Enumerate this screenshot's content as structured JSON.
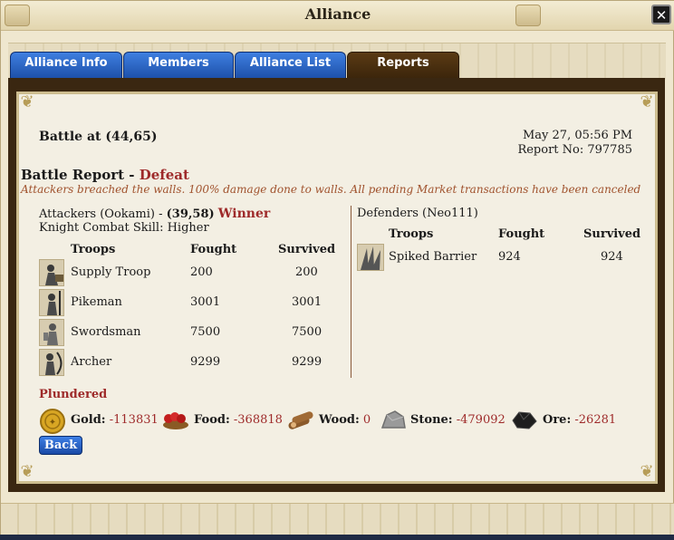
{
  "window": {
    "title": "Alliance",
    "close_label": "✕"
  },
  "tabs": [
    {
      "label": "Alliance Info"
    },
    {
      "label": "Members"
    },
    {
      "label": "Alliance List"
    },
    {
      "label": "Reports"
    }
  ],
  "report": {
    "heading": "Battle at (44,65)",
    "date": "May 27, 05:56 PM",
    "report_no": "Report No: 797785",
    "title_prefix": "Battle Report - ",
    "result": "Defeat",
    "summary": "Attackers breached the walls. 100% damage done to walls. All pending Market transactions have been canceled"
  },
  "attackers": {
    "label": "Attackers (Ookami) - ",
    "coords": "(39,58)",
    "outcome": "Winner",
    "skill": "Knight Combat Skill: Higher",
    "columns": {
      "troops": "Troops",
      "fought": "Fought",
      "survived": "Survived"
    },
    "rows": [
      {
        "name": "Supply Troop",
        "fought": "200",
        "survived": "200",
        "icon": "supply-troop-icon"
      },
      {
        "name": "Pikeman",
        "fought": "3001",
        "survived": "3001",
        "icon": "pikeman-icon"
      },
      {
        "name": "Swordsman",
        "fought": "7500",
        "survived": "7500",
        "icon": "swordsman-icon"
      },
      {
        "name": "Archer",
        "fought": "9299",
        "survived": "9299",
        "icon": "archer-icon"
      }
    ]
  },
  "defenders": {
    "label": "Defenders (Neo111)",
    "columns": {
      "troops": "Troops",
      "fought": "Fought",
      "survived": "Survived"
    },
    "rows": [
      {
        "name": "Spiked Barrier",
        "fought": "924",
        "survived": "924",
        "icon": "spiked-barrier-icon"
      }
    ]
  },
  "plundered": {
    "title": "Plundered",
    "gold": {
      "label": "Gold:",
      "value": "-113831"
    },
    "food": {
      "label": "Food:",
      "value": "-368818"
    },
    "wood": {
      "label": "Wood:",
      "value": "0"
    },
    "stone": {
      "label": "Stone:",
      "value": "-479092"
    },
    "ore": {
      "label": "Ore:",
      "value": "-26281"
    }
  },
  "back_label": "Back",
  "colors": {
    "accent_red": "#9e2a2a",
    "tab_blue": "#1c4fa8",
    "tab_active": "#3b250b"
  }
}
